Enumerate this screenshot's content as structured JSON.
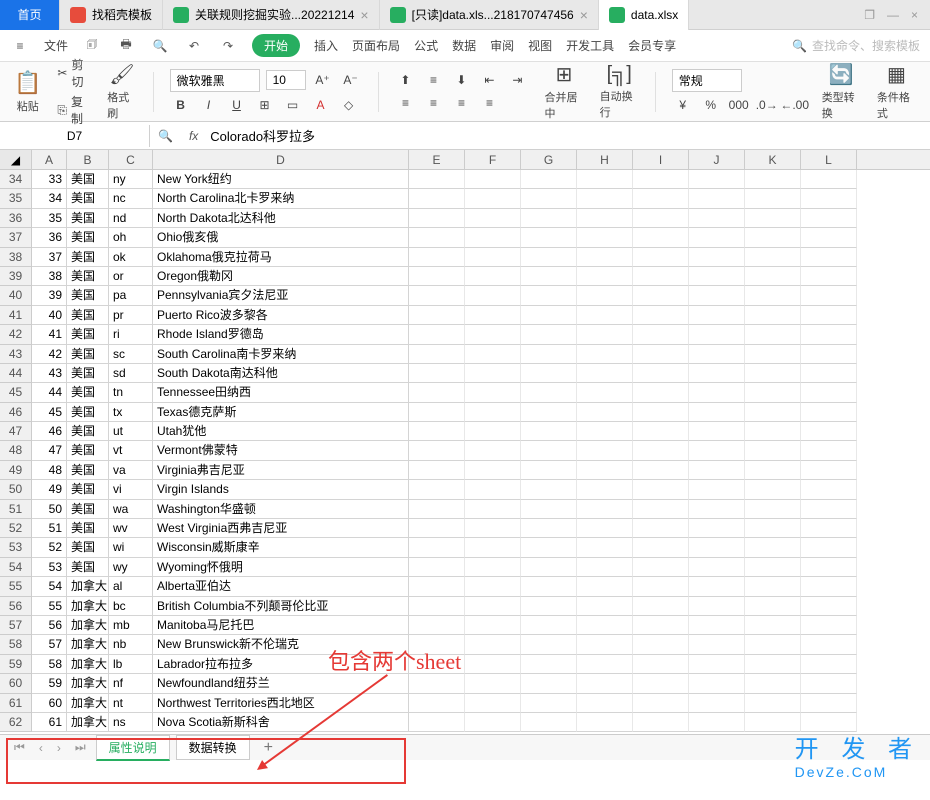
{
  "tabs": {
    "home": "首页",
    "t1": "找稻壳模板",
    "t2": "关联规则挖掘实验...20221214",
    "t3": "[只读]data.xls...218170747456",
    "t4": "data.xlsx"
  },
  "menu": {
    "file": "文件",
    "start": "开始",
    "insert": "插入",
    "layout": "页面布局",
    "formula": "公式",
    "data": "数据",
    "review": "审阅",
    "view": "视图",
    "dev": "开发工具",
    "member": "会员专享",
    "search_ph": "查找命令、搜索模板"
  },
  "ribbon": {
    "paste": "粘贴",
    "cut": "剪切",
    "copy": "复制",
    "fmtpaint": "格式刷",
    "font": "微软雅黑",
    "size": "10",
    "merge": "合并居中",
    "wrap": "自动换行",
    "general": "常规",
    "typeconv": "类型转换",
    "condfmt": "条件格式"
  },
  "cell_ref": "D7",
  "formula": "Colorado科罗拉多",
  "cols": [
    "A",
    "B",
    "C",
    "D",
    "E",
    "F",
    "G",
    "H",
    "I",
    "J",
    "K",
    "L"
  ],
  "rows": [
    {
      "n": 34,
      "A": "33",
      "B": "美国",
      "C": "ny",
      "D": "New York纽约"
    },
    {
      "n": 35,
      "A": "34",
      "B": "美国",
      "C": "nc",
      "D": "North Carolina北卡罗来纳"
    },
    {
      "n": 36,
      "A": "35",
      "B": "美国",
      "C": "nd",
      "D": "North Dakota北达科他"
    },
    {
      "n": 37,
      "A": "36",
      "B": "美国",
      "C": "oh",
      "D": "Ohio俄亥俄"
    },
    {
      "n": 38,
      "A": "37",
      "B": "美国",
      "C": "ok",
      "D": "Oklahoma俄克拉荷马"
    },
    {
      "n": 39,
      "A": "38",
      "B": "美国",
      "C": "or",
      "D": "Oregon俄勒冈"
    },
    {
      "n": 40,
      "A": "39",
      "B": "美国",
      "C": "pa",
      "D": "Pennsylvania宾夕法尼亚"
    },
    {
      "n": 41,
      "A": "40",
      "B": "美国",
      "C": "pr",
      "D": "Puerto Rico波多黎各"
    },
    {
      "n": 42,
      "A": "41",
      "B": "美国",
      "C": "ri",
      "D": "Rhode Island罗德岛"
    },
    {
      "n": 43,
      "A": "42",
      "B": "美国",
      "C": "sc",
      "D": "South Carolina南卡罗来纳"
    },
    {
      "n": 44,
      "A": "43",
      "B": "美国",
      "C": "sd",
      "D": "South Dakota南达科他"
    },
    {
      "n": 45,
      "A": "44",
      "B": "美国",
      "C": "tn",
      "D": "Tennessee田纳西"
    },
    {
      "n": 46,
      "A": "45",
      "B": "美国",
      "C": "tx",
      "D": "Texas德克萨斯"
    },
    {
      "n": 47,
      "A": "46",
      "B": "美国",
      "C": "ut",
      "D": "Utah犹他"
    },
    {
      "n": 48,
      "A": "47",
      "B": "美国",
      "C": "vt",
      "D": "Vermont佛蒙特"
    },
    {
      "n": 49,
      "A": "48",
      "B": "美国",
      "C": "va",
      "D": "Virginia弗吉尼亚"
    },
    {
      "n": 50,
      "A": "49",
      "B": "美国",
      "C": "vi",
      "D": "Virgin Islands"
    },
    {
      "n": 51,
      "A": "50",
      "B": "美国",
      "C": "wa",
      "D": "Washington华盛顿"
    },
    {
      "n": 52,
      "A": "51",
      "B": "美国",
      "C": "wv",
      "D": "West Virginia西弗吉尼亚"
    },
    {
      "n": 53,
      "A": "52",
      "B": "美国",
      "C": "wi",
      "D": "Wisconsin威斯康辛"
    },
    {
      "n": 54,
      "A": "53",
      "B": "美国",
      "C": "wy",
      "D": "Wyoming怀俄明"
    },
    {
      "n": 55,
      "A": "54",
      "B": "加拿大",
      "C": "al",
      "D": "Alberta亚伯达"
    },
    {
      "n": 56,
      "A": "55",
      "B": "加拿大",
      "C": "bc",
      "D": "British Columbia不列颠哥伦比亚"
    },
    {
      "n": 57,
      "A": "56",
      "B": "加拿大",
      "C": "mb",
      "D": "Manitoba马尼托巴"
    },
    {
      "n": 58,
      "A": "57",
      "B": "加拿大",
      "C": "nb",
      "D": "New Brunswick新不伦瑞克"
    },
    {
      "n": 59,
      "A": "58",
      "B": "加拿大",
      "C": "lb",
      "D": "Labrador拉布拉多"
    },
    {
      "n": 60,
      "A": "59",
      "B": "加拿大",
      "C": "nf",
      "D": "Newfoundland纽芬兰"
    },
    {
      "n": 61,
      "A": "60",
      "B": "加拿大",
      "C": "nt",
      "D": "Northwest Territories西北地区"
    },
    {
      "n": 62,
      "A": "61",
      "B": "加拿大",
      "C": "ns",
      "D": "Nova Scotia新斯科舍"
    }
  ],
  "sheets": {
    "s1": "属性说明",
    "s2": "数据转换"
  },
  "annotation": "包含两个sheet",
  "watermark": {
    "line1": "开 发 者",
    "line2": "DevZe.CoM"
  }
}
